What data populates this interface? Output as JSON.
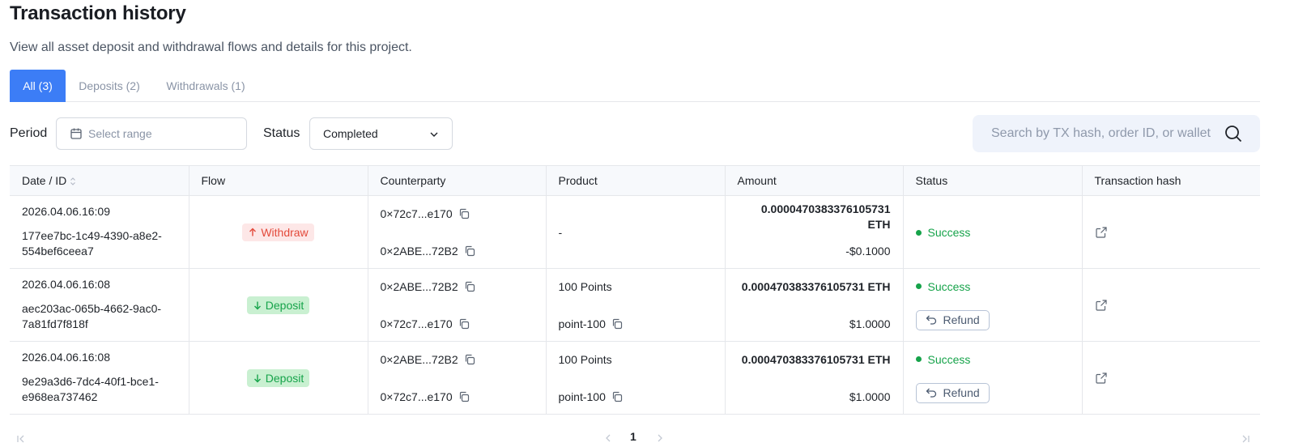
{
  "header": {
    "title": "Transaction history",
    "subtitle": "View all asset deposit and withdrawal flows and details for this project."
  },
  "tabs": [
    {
      "label": "All (3)",
      "active": true
    },
    {
      "label": "Deposits (2)",
      "active": false
    },
    {
      "label": "Withdrawals (1)",
      "active": false
    }
  ],
  "filters": {
    "period_label": "Period",
    "period_placeholder": "Select range",
    "status_label": "Status",
    "status_value": "Completed",
    "search_placeholder": "Search by TX hash, order ID, or wallet"
  },
  "table": {
    "headers": {
      "date_id": "Date / ID",
      "flow": "Flow",
      "counterparty": "Counterparty",
      "product": "Product",
      "amount": "Amount",
      "status": "Status",
      "tx_hash": "Transaction hash"
    },
    "rows": [
      {
        "date": "2026.04.06.16:09",
        "id": "177ee7bc-1c49-4390-a8e2-554bef6ceea7",
        "flow": "Withdraw",
        "counterparty_top": "0×72c7...e170",
        "counterparty_bottom": "0×2ABE...72B2",
        "product": "-",
        "amount": "0.0000470383376105731 ETH",
        "amount_usd": "-$0.1000",
        "status": "Success"
      },
      {
        "date": "2026.04.06.16:08",
        "id": "aec203ac-065b-4662-9ac0-7a81fd7f818f",
        "flow": "Deposit",
        "counterparty_top": "0×2ABE...72B2",
        "counterparty_bottom": "0×72c7...e170",
        "product_name": "100 Points",
        "product_code": "point-100",
        "amount": "0.000470383376105731 ETH",
        "amount_usd": "$1.0000",
        "status": "Success",
        "action": "Refund"
      },
      {
        "date": "2026.04.06.16:08",
        "id": "9e29a3d6-7dc4-40f1-bce1-e968ea737462",
        "flow": "Deposit",
        "counterparty_top": "0×2ABE...72B2",
        "counterparty_bottom": "0×72c7...e170",
        "product_name": "100 Points",
        "product_code": "point-100",
        "amount": "0.000470383376105731 ETH",
        "amount_usd": "$1.0000",
        "status": "Success",
        "action": "Refund"
      }
    ]
  },
  "pagination": {
    "current_page": "1"
  },
  "colors": {
    "accent": "#3c7df6",
    "success": "#16a34a",
    "withdraw": "#e34a3b"
  }
}
